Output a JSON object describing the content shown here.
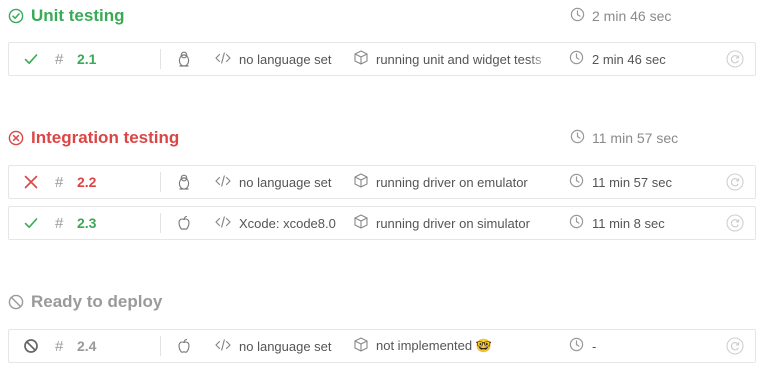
{
  "stages": [
    {
      "name": "Unit testing",
      "state": "passed",
      "status_icon": "check-circle-icon",
      "duration": "2 min 46 sec",
      "jobs": [
        {
          "number": "2.1",
          "state": "passed",
          "status_icon": "check-icon",
          "os_icon": "linux-tux-icon",
          "language": "no language set",
          "env": "running unit and widget tests",
          "duration": "2 min 46 sec"
        }
      ]
    },
    {
      "name": "Integration testing",
      "state": "failed",
      "status_icon": "x-circle-icon",
      "duration": "11 min 57 sec",
      "jobs": [
        {
          "number": "2.2",
          "state": "failed",
          "status_icon": "x-icon",
          "os_icon": "linux-tux-icon",
          "language": "no language set",
          "env": "running driver on emulator",
          "duration": "11 min 57 sec"
        },
        {
          "number": "2.3",
          "state": "passed",
          "status_icon": "check-icon",
          "os_icon": "apple-icon",
          "language": "Xcode: xcode8.0",
          "env": "running driver on simulator",
          "duration": "11 min 8 sec"
        }
      ]
    },
    {
      "name": "Ready to deploy",
      "state": "skipped",
      "status_icon": "cancel-circle-icon",
      "duration": "",
      "jobs": [
        {
          "number": "2.4",
          "state": "skipped",
          "status_icon": "cancel-icon",
          "os_icon": "apple-icon",
          "language": "no language set",
          "env": "not implemented 🤓",
          "duration": "-"
        }
      ]
    }
  ],
  "colors": {
    "passed": "#39aa56",
    "failed": "#db4545",
    "skipped": "#9a9a9a"
  }
}
